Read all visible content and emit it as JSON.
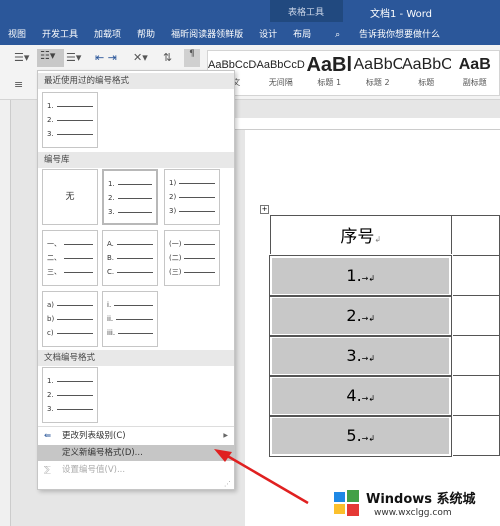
{
  "titlebar": {
    "context": "表格工具",
    "title": "文档1 - Word"
  },
  "tabs": [
    "视图",
    "开发工具",
    "加载项",
    "帮助",
    "福昕阅读器领鲜版",
    "设计",
    "布局"
  ],
  "tell_me": "告诉我你想要做什么",
  "styles": [
    {
      "preview": "AaBbCcDd",
      "name": "正文"
    },
    {
      "preview": "AaBbCcDd",
      "name": "无间隔"
    },
    {
      "preview": "AaBl",
      "name": "标题 1"
    },
    {
      "preview": "AaBbC",
      "name": "标题 2"
    },
    {
      "preview": "AaBbC",
      "name": "标题"
    },
    {
      "preview": "AaB",
      "name": "副标题"
    }
  ],
  "menu": {
    "recent_header": "最近使用过的编号格式",
    "library_header": "编号库",
    "doc_header": "文档编号格式",
    "none": "无",
    "change_level": "更改列表级别(C)",
    "define_new": "定义新编号格式(D)...",
    "set_value": "设置编号值(V)..."
  },
  "formats": {
    "arabic": [
      "1.",
      "2.",
      "3."
    ],
    "paren": [
      "1)",
      "2)",
      "3)"
    ],
    "chinese": [
      "一、",
      "二、",
      "三、"
    ],
    "upper": [
      "A.",
      "B.",
      "C."
    ],
    "chinese_paren": [
      "(一)",
      "(二)",
      "(三)"
    ],
    "lower": [
      "a)",
      "b)",
      "c)"
    ],
    "roman": [
      "i.",
      "ii.",
      "iii."
    ]
  },
  "table": {
    "header": "序号",
    "rows": [
      "1.",
      "2.",
      "3.",
      "4.",
      "5."
    ]
  },
  "watermark": {
    "brand": "Windows 系统城",
    "url": "www.wxclgg.com"
  },
  "colors": {
    "word_blue": "#2b579a",
    "arrow": "#e02020"
  }
}
